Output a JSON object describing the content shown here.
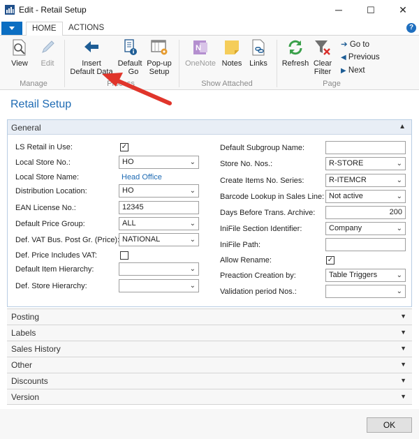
{
  "window": {
    "title": "Edit - Retail Setup",
    "minimize": "─",
    "maximize": "☐",
    "close": "✕"
  },
  "ribbon_tabs": {
    "home": "HOME",
    "actions": "ACTIONS",
    "help": "?"
  },
  "ribbon": {
    "view": "View",
    "edit": "Edit",
    "insert_default_data": [
      "Insert",
      "Default Data"
    ],
    "default_go": [
      "Default",
      "Go"
    ],
    "popup_setup": [
      "Pop-up",
      "Setup"
    ],
    "onenote": "OneNote",
    "notes": "Notes",
    "links": "Links",
    "refresh": "Refresh",
    "clear_filter": [
      "Clear",
      "Filter"
    ],
    "go_to": "Go to",
    "previous": "Previous",
    "next": "Next",
    "groups": {
      "manage": "Manage",
      "process": "Process",
      "show_attached": "Show Attached",
      "page": "Page"
    }
  },
  "page_title": "Retail Setup",
  "general": {
    "header": "General",
    "left": {
      "ls_retail_in_use": {
        "label": "LS Retail in Use:",
        "checked": true
      },
      "local_store_no": {
        "label": "Local Store No.:",
        "value": "HO"
      },
      "local_store_name": {
        "label": "Local Store Name:",
        "value": "Head Office"
      },
      "distribution_location": {
        "label": "Distribution Location:",
        "value": "HO"
      },
      "ean_license_no": {
        "label": "EAN License No.:",
        "value": "12345"
      },
      "default_price_group": {
        "label": "Default Price Group:",
        "value": "ALL"
      },
      "def_vat_bus_post_gr": {
        "label": "Def. VAT Bus. Post Gr. (Price):",
        "value": "NATIONAL"
      },
      "def_price_includes_vat": {
        "label": "Def. Price Includes VAT:",
        "checked": false
      },
      "default_item_hierarchy": {
        "label": "Default Item Hierarchy:",
        "value": ""
      },
      "def_store_hierarchy": {
        "label": "Def. Store Hierarchy:",
        "value": ""
      }
    },
    "right": {
      "default_subgroup_name": {
        "label": "Default Subgroup Name:",
        "value": ""
      },
      "store_no_nos": {
        "label": "Store No. Nos.:",
        "value": "R-STORE"
      },
      "create_items_no_series": {
        "label": "Create Items No. Series:",
        "value": "R-ITEMCR"
      },
      "barcode_lookup": {
        "label": "Barcode Lookup in Sales Line:",
        "value": "Not active"
      },
      "days_before_archive": {
        "label": "Days Before Trans. Archive:",
        "value": "200"
      },
      "inifile_section": {
        "label": "IniFile Section Identifier:",
        "value": "Company"
      },
      "inifile_path": {
        "label": "IniFile Path:",
        "value": ""
      },
      "allow_rename": {
        "label": "Allow Rename:",
        "checked": true
      },
      "preaction_creation": {
        "label": "Preaction Creation by:",
        "value": "Table Triggers"
      },
      "validation_period_nos": {
        "label": "Validation period Nos.:",
        "value": ""
      }
    }
  },
  "sections": [
    "Posting",
    "Labels",
    "Sales History",
    "Other",
    "Discounts",
    "Version"
  ],
  "ok_button": "OK",
  "colors": {
    "accent": "#1d6ab3",
    "annotation_arrow": "#e0352b",
    "menu_button": "#0b6ec2"
  }
}
